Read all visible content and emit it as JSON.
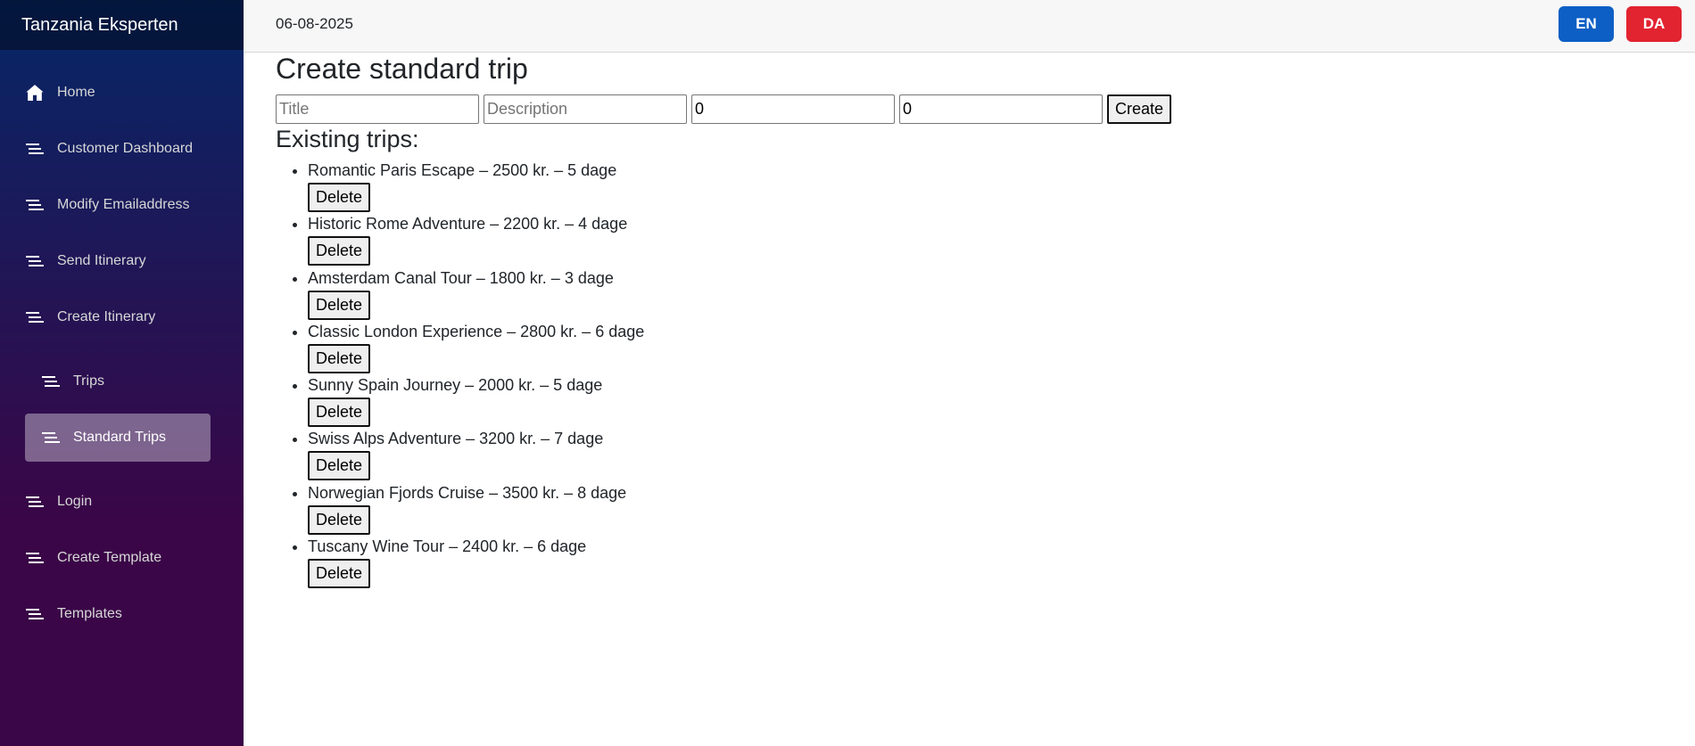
{
  "app": {
    "brand": "Tanzania Eksperten"
  },
  "sidebar": {
    "items": [
      {
        "label": "Home",
        "icon": "home-icon"
      },
      {
        "label": "Customer Dashboard",
        "icon": "list-icon"
      },
      {
        "label": "Modify Emailaddress",
        "icon": "list-icon"
      },
      {
        "label": "Send Itinerary",
        "icon": "list-icon"
      },
      {
        "label": "Create Itinerary",
        "icon": "list-icon"
      },
      {
        "label": "Trips",
        "icon": "list-icon"
      },
      {
        "label": "Standard Trips",
        "icon": "list-icon",
        "active": true
      },
      {
        "label": "Login",
        "icon": "list-icon"
      },
      {
        "label": "Create Template",
        "icon": "list-icon"
      },
      {
        "label": "Templates",
        "icon": "list-icon"
      }
    ]
  },
  "topbar": {
    "date": "06-08-2025",
    "lang_en": "EN",
    "lang_da": "DA"
  },
  "main": {
    "heading": "Create standard trip",
    "form": {
      "title_placeholder": "Title",
      "description_placeholder": "Description",
      "price_value": "0",
      "days_value": "0",
      "create_label": "Create"
    },
    "list_heading": "Existing trips:",
    "delete_label": "Delete",
    "trips": [
      "Romantic Paris Escape – 2500 kr. – 5 dage",
      "Historic Rome Adventure – 2200 kr. – 4 dage",
      "Amsterdam Canal Tour – 1800 kr. – 3 dage",
      "Classic London Experience – 2800 kr. – 6 dage",
      "Sunny Spain Journey – 2000 kr. – 5 dage",
      "Swiss Alps Adventure – 3200 kr. – 7 dage",
      "Norwegian Fjords Cruise – 3500 kr. – 8 dage",
      "Tuscany Wine Tour – 2400 kr. – 6 dage"
    ]
  },
  "colors": {
    "lang_en": "#0d5fc5",
    "lang_da": "#e22330",
    "sidebar_top": "#052767",
    "sidebar_bottom": "#3a0647"
  }
}
